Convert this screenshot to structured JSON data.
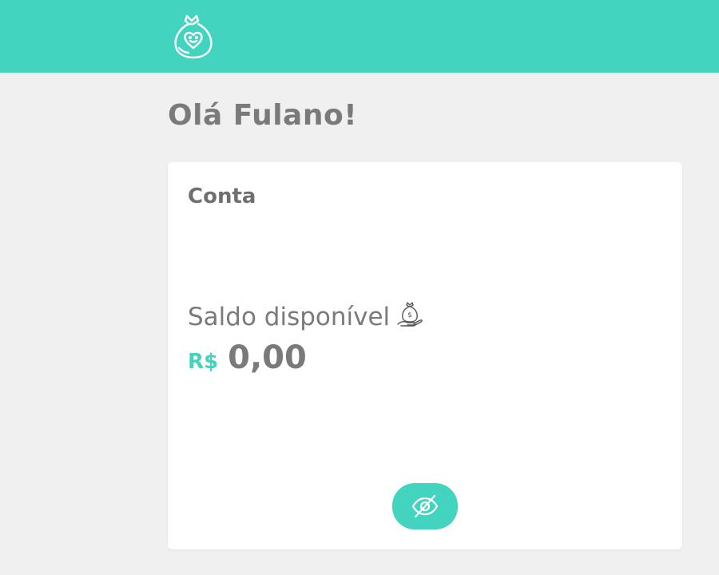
{
  "header": {
    "logo_icon": "money-bag-heart-icon",
    "bar_color": "#43d4c0"
  },
  "greeting": {
    "text": "Olá Fulano!"
  },
  "account_card": {
    "title": "Conta",
    "balance_label": "Saldo disponível",
    "balance_icon": "money-bag-hand-icon",
    "currency": "R$",
    "amount": "0,00",
    "toggle_visibility_icon": "eye-off-icon",
    "accent_color": "#43d4c0"
  }
}
